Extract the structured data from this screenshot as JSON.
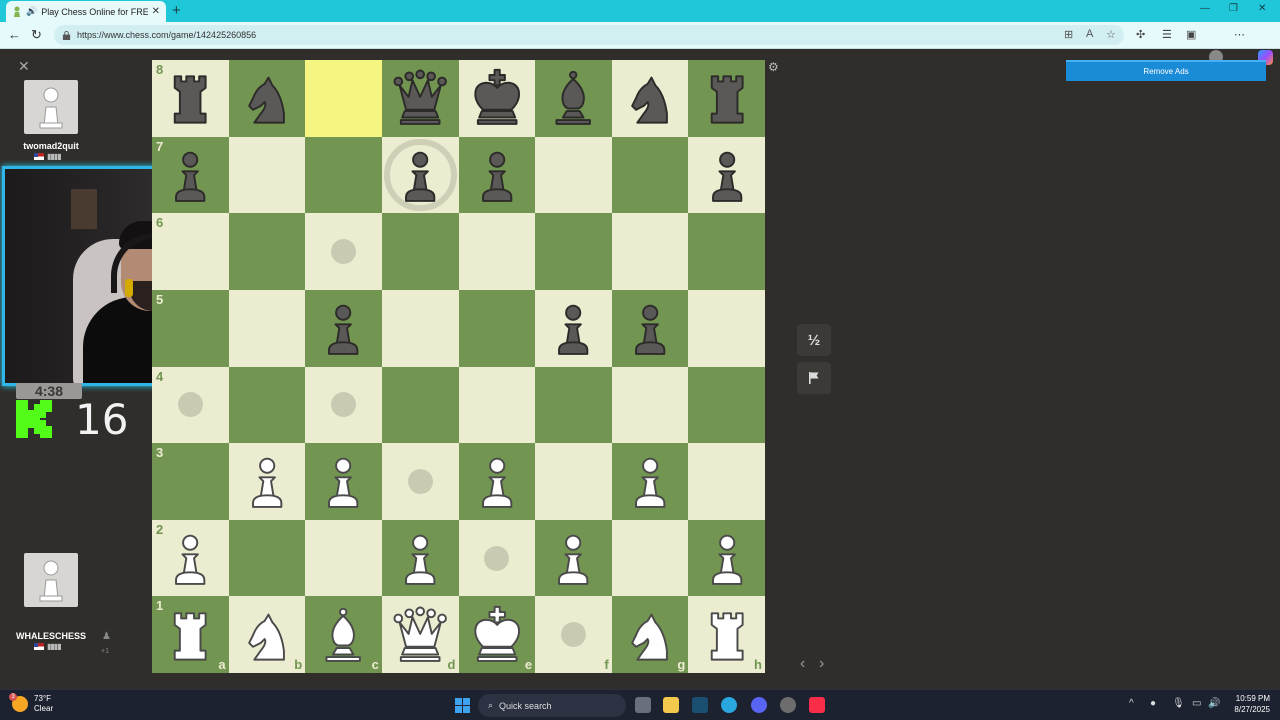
{
  "browser": {
    "tab_title": "Play Chess Online for FREE",
    "url": "https://www.chess.com/game/142425260856",
    "new_tab_glyph": "+",
    "close_glyph": "✕"
  },
  "players": {
    "top": {
      "name": "twomad2quit",
      "rating_bars": "▮▮▮▮"
    },
    "bottom": {
      "name": "WHALESCHESS",
      "rating_bars": "▮▮▮▮",
      "extra": "+1"
    }
  },
  "stream": {
    "clock": "4:38",
    "kick_count": "16"
  },
  "board": {
    "light_color": "#ebecd0",
    "dark_color": "#739552",
    "highlight_color": "#f5f682",
    "ranks": [
      "8",
      "7",
      "6",
      "5",
      "4",
      "3",
      "2",
      "1"
    ],
    "files": [
      "a",
      "b",
      "c",
      "d",
      "e",
      "f",
      "g",
      "h"
    ],
    "position": [
      [
        "bR",
        "bN",
        "",
        "bQ",
        "bK",
        "bB",
        "bN",
        "bR"
      ],
      [
        "bP",
        "",
        "",
        "bP",
        "bP",
        "",
        "",
        "bP"
      ],
      [
        "",
        "",
        "",
        "",
        "",
        "",
        "",
        ""
      ],
      [
        "",
        "",
        "bP",
        "",
        "",
        "bP",
        "bP",
        ""
      ],
      [
        "",
        "",
        "",
        "",
        "",
        "",
        "",
        ""
      ],
      [
        "",
        "wP",
        "wP",
        "",
        "wP",
        "",
        "wP",
        ""
      ],
      [
        "wP",
        "",
        "",
        "wP",
        "",
        "wP",
        "",
        "wP"
      ],
      [
        "wR",
        "wN",
        "wB",
        "wQ",
        "wK",
        "",
        "wN",
        "wR"
      ]
    ],
    "highlight_squares": [
      "c8"
    ],
    "move_dots": [
      "c6",
      "c4",
      "a4",
      "d3",
      "e2",
      "f1"
    ],
    "capture_rings": [
      "d7"
    ]
  },
  "controls": {
    "draw_label": "½",
    "remove_ads_label": "Remove Ads"
  },
  "taskbar": {
    "weather_temp": "73°F",
    "weather_desc": "Clear",
    "weather_badge": "3",
    "search_label": "Quick search",
    "time": "10:59 PM",
    "date": "8/27/2025"
  },
  "colors": {
    "tabbar": "#1fc7d9",
    "app_bg": "#302e2b",
    "webcam_border": "#2fb6e6",
    "remove_ads": "#1a8bd6",
    "kick_green": "#53fc18"
  }
}
